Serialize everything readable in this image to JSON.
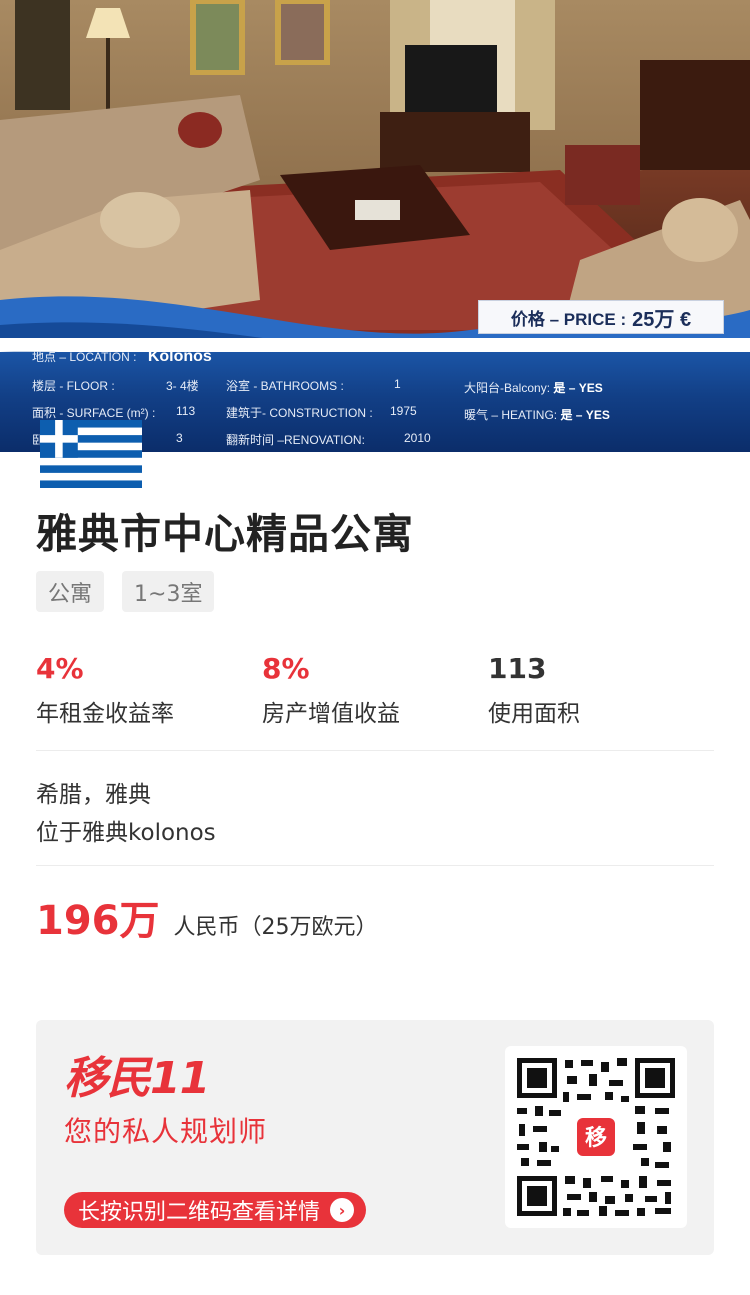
{
  "hero": {
    "price_label": "价格 – PRICE :",
    "price_value": "25万 €",
    "location_label": "地点 – LOCATION :",
    "location_value": "Kolonos",
    "floor_label": "楼层 - FLOOR :",
    "floor_value": "3- 4楼",
    "surface_label": "面积 - SURFACE (m²) :",
    "surface_value": "113",
    "rooms_label": "卧",
    "rooms_value": "3",
    "bath_label": "浴室 - BATHROOMS :",
    "bath_value": "1",
    "construction_label": "建筑于- CONSTRUCTION :",
    "construction_value": "1975",
    "renovation_label": "翻新时间 –RENOVATION:",
    "renovation_value": "2010",
    "balcony_label": "大阳台-Balcony:",
    "balcony_value": "是 – YES",
    "heating_label": "暖气 – HEATING:",
    "heating_value": "是 – YES"
  },
  "listing": {
    "title": "雅典市中心精品公寓",
    "tags": [
      "公寓",
      "1~3室"
    ],
    "stats": [
      {
        "value": "4%",
        "label": "年租金收益率"
      },
      {
        "value": "8%",
        "label": "房产增值收益"
      },
      {
        "value": "113",
        "label": "使用面积"
      }
    ],
    "address_line1": "希腊，雅典",
    "address_line2": "位于雅典kolonos",
    "price_main": "196万",
    "price_sub": "人民币（25万欧元）"
  },
  "card": {
    "brand": "移民11",
    "slogan": "您的私人规划师",
    "cta": "长按识别二维码查看详情",
    "qr_center": "移"
  },
  "colors": {
    "accent": "#e8333a",
    "banner_blue": "#123f86",
    "greece_blue": "#0d5eaf"
  }
}
